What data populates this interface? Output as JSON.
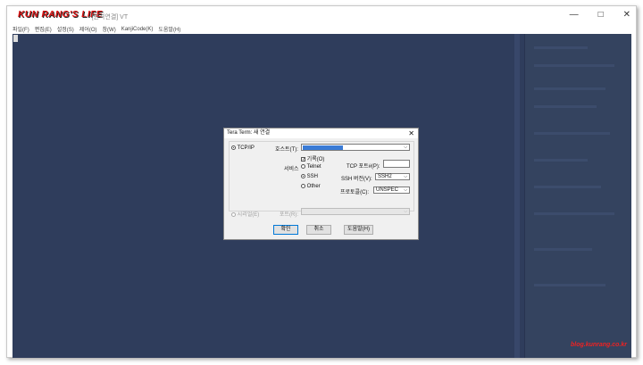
{
  "window": {
    "logo_text": "KUN RANG'S LIFE",
    "title": "- - [원격연결] VT",
    "min_icon": "minimize-icon",
    "max_icon": "maximize-icon",
    "close_icon": "close-icon"
  },
  "menu": [
    "파일(F)",
    "편집(E)",
    "설정(S)",
    "제어(O)",
    "창(W)",
    "KanjiCode(K)",
    "도움말(H)"
  ],
  "watermark": "blog.kunrang.co.kr",
  "dialog": {
    "title": "Tera Term: 새 연결",
    "tcpip_label": "TCP/IP",
    "host_label": "호스트(T):",
    "history_label": "기록(O)",
    "service_label": "서비스",
    "telnet_label": "Telnet",
    "ssh_label": "SSH",
    "other_label": "Other",
    "tcp_port_label": "TCP 포트#(P):",
    "ssh_version_label": "SSH 버전(V):",
    "ssh_version_value": "SSH2",
    "protocol_label": "프로토콜(C):",
    "protocol_value": "UNSPEC",
    "serial_label": "시리얼(E)",
    "port_label": "포트(R):",
    "ok_label": "확인",
    "cancel_label": "취소",
    "help_label": "도움말(H)"
  }
}
